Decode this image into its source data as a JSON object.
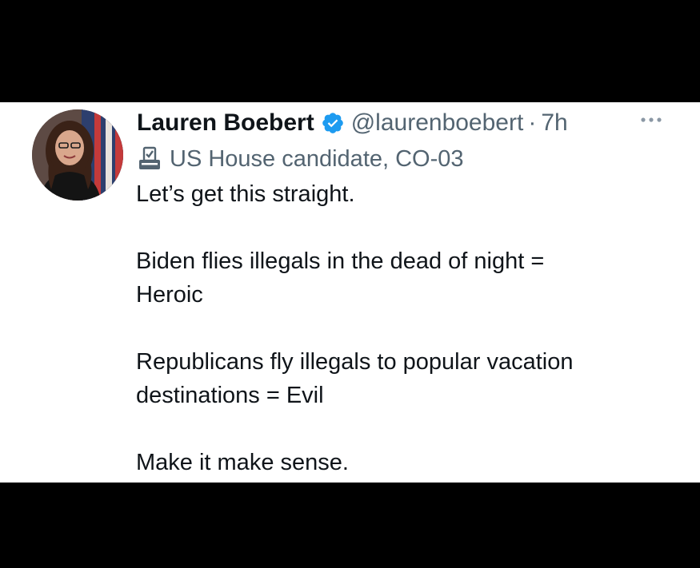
{
  "tweet": {
    "author_name": "Lauren Boebert",
    "handle": "@laurenboebert",
    "separator": "·",
    "time": "7h",
    "label": "US House candidate, CO-03",
    "paragraphs": [
      {
        "lines": [
          "Let’s get this straight."
        ]
      },
      {
        "lines": [
          "Biden flies illegals in the dead of night =",
          "Heroic"
        ]
      },
      {
        "lines": [
          "Republicans fly illegals to popular vacation",
          "destinations = Evil"
        ]
      },
      {
        "lines": [
          "Make it make sense."
        ]
      }
    ]
  },
  "icons": {
    "verified": "verified-badge-icon",
    "more": "more-options-icon",
    "label": "ballot-box-icon"
  },
  "colors": {
    "background": "#000000",
    "card": "#ffffff",
    "text_primary": "#0f1419",
    "text_secondary": "#536471",
    "verified_blue": "#1d9bf0"
  }
}
